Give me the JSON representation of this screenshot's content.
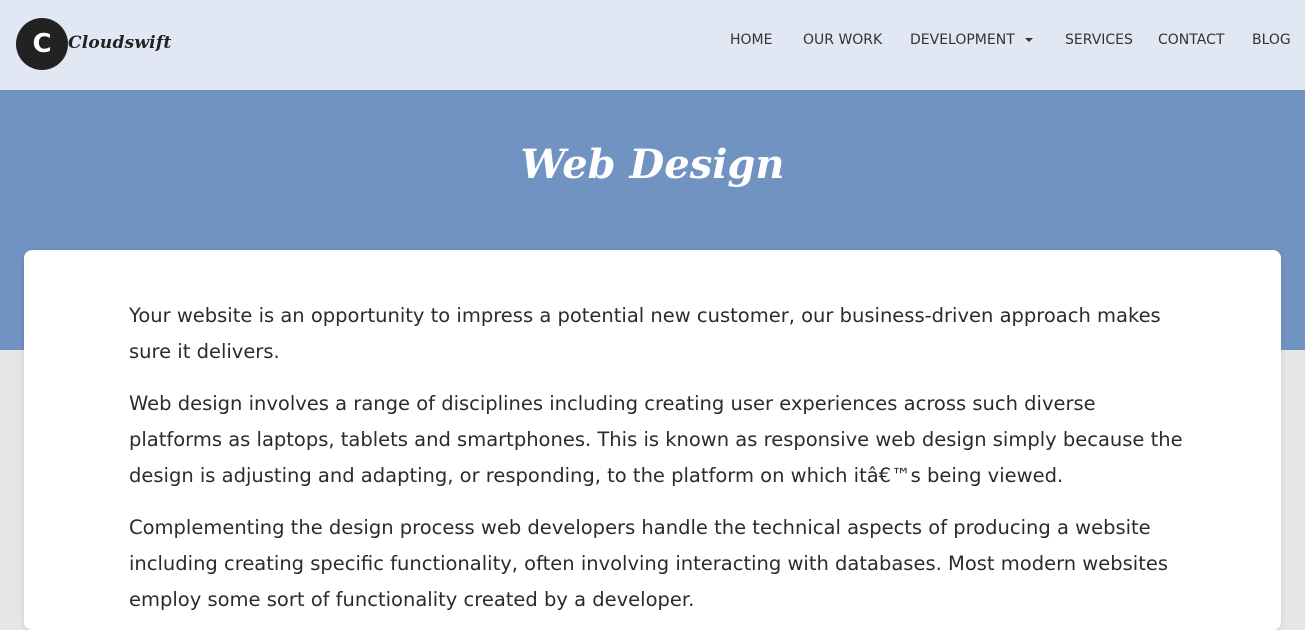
{
  "brand": {
    "logo_letter": "C",
    "name": "Cloudswift"
  },
  "nav": {
    "items": [
      {
        "label": "HOME"
      },
      {
        "label": "OUR WORK"
      },
      {
        "label": "DEVELOPMENT",
        "has_dropdown": true
      },
      {
        "label": "SERVICES"
      },
      {
        "label": "CONTACT"
      },
      {
        "label": "BLOG"
      }
    ],
    "dropdown_icon": "caret-down-icon"
  },
  "hero": {
    "title": "Web Design"
  },
  "content": {
    "paragraphs": [
      "Your website is an opportunity to impress a potential new customer, our business-driven approach makes sure it delivers.",
      "Web design involves a range of disciplines including creating user experiences across such diverse platforms as laptops, tablets and smartphones. This is known as responsive web design simply because the design is adjusting and adapting, or responding, to the platform on which itâ€™s being viewed.",
      "Complementing the design process web developers handle the technical aspects of producing a website including creating specific functionality, often involving interacting with databases. Most modern websites employ some sort of functionality created by a developer."
    ]
  },
  "colors": {
    "navbar_bg": "#e2e8f3",
    "hero_bg": "#7093c1",
    "page_bg": "#e6e6e6",
    "card_bg": "#ffffff",
    "text": "#2b2b2b",
    "logo_circle": "#222222"
  }
}
